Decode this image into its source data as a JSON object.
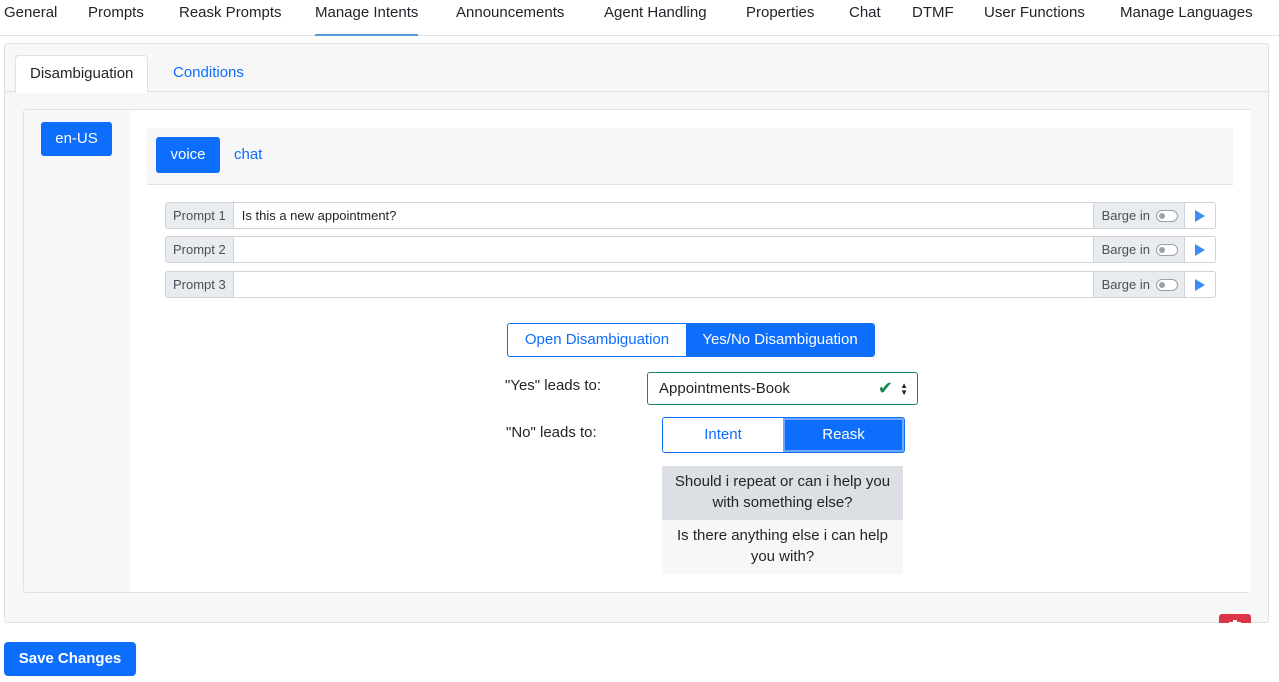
{
  "nav": {
    "items": [
      "General",
      "Prompts",
      "Reask Prompts",
      "Manage Intents",
      "Announcements",
      "Agent Handling",
      "Properties",
      "Chat",
      "DTMF",
      "User Functions",
      "Manage Languages"
    ],
    "active": "Manage Intents"
  },
  "tabs": {
    "disambiguation": "Disambiguation",
    "conditions": "Conditions"
  },
  "language": "en-US",
  "channels": {
    "voice": "voice",
    "chat": "chat"
  },
  "prompts": [
    {
      "label": "Prompt 1",
      "value": "Is this a new appointment?",
      "barge_label": "Barge in",
      "barge_on": false
    },
    {
      "label": "Prompt 2",
      "value": "",
      "barge_label": "Barge in",
      "barge_on": false
    },
    {
      "label": "Prompt 3",
      "value": "",
      "barge_label": "Barge in",
      "barge_on": false
    }
  ],
  "disambiguation_mode": {
    "open": "Open Disambiguation",
    "yesno": "Yes/No Disambiguation",
    "selected": "Yes/No Disambiguation"
  },
  "yes_leads_to": {
    "label": "\"Yes\" leads to:",
    "value": "Appointments-Book"
  },
  "no_leads_to": {
    "label": "\"No\" leads to:",
    "intent": "Intent",
    "reask": "Reask",
    "selected": "Reask"
  },
  "reask_options": [
    {
      "text": "Should i repeat or can i help you with something else?",
      "selected": true
    },
    {
      "text": "Is there anything else i can help you with?",
      "selected": false
    }
  ],
  "save_label": "Save Changes",
  "colors": {
    "primary": "#0d6efd",
    "success": "#198754",
    "danger": "#dc3545",
    "active_underline": "#5b9bd5"
  },
  "icons": {
    "play": "play-icon",
    "check": "check-icon",
    "select_arrows": "sort-arrows-icon",
    "trash": "trash-icon"
  }
}
